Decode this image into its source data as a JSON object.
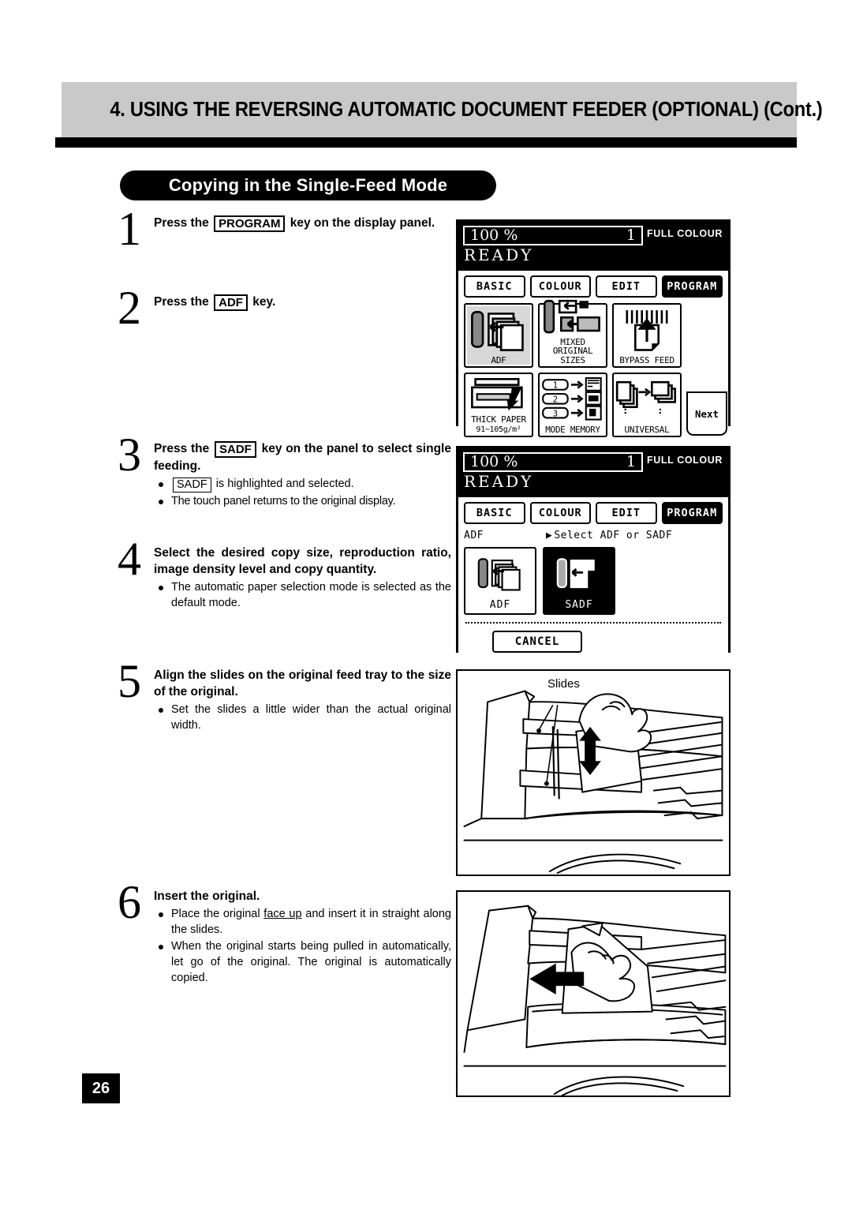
{
  "header": {
    "chapter_title": "4. USING THE REVERSING AUTOMATIC DOCUMENT FEEDER (OPTIONAL) (Cont.)",
    "section_title": "Copying in the Single-Feed Mode"
  },
  "page_number": "26",
  "steps": [
    {
      "num": "1",
      "head_pre": "Press the",
      "head_key": "PROGRAM",
      "head_post": "key on the display panel.",
      "bullets": []
    },
    {
      "num": "2",
      "head_pre": "Press the",
      "head_key": "ADF",
      "head_post": "key.",
      "bullets": []
    },
    {
      "num": "3",
      "head_pre": "Press the",
      "head_key": "SADF",
      "head_post": "key on the panel to select single feeding.",
      "bullets": [
        {
          "key": "SADF",
          "text": "is highlighted and selected."
        },
        {
          "key": "",
          "text": "The touch panel returns to the original display."
        }
      ]
    },
    {
      "num": "4",
      "head_pre": "",
      "head_key": "",
      "head_post": "Select the desired copy size, reproduction ratio, image density level and copy quantity.",
      "bullets": [
        {
          "key": "",
          "text": "The automatic paper selection mode is selected as the default mode."
        }
      ]
    },
    {
      "num": "5",
      "head_pre": "",
      "head_key": "",
      "head_post": "Align the slides on the original feed tray to the size of the original.",
      "bullets": [
        {
          "key": "",
          "text": "Set the slides a little wider than the actual original width."
        }
      ]
    },
    {
      "num": "6",
      "head_pre": "",
      "head_key": "",
      "head_post": "Insert the original.",
      "bullets": [
        {
          "key": "",
          "text": "Place the original face up and insert it in straight along the slides."
        },
        {
          "key": "",
          "text": "When the original starts being pulled in automatically, let go of the original. The original is automatically copied."
        }
      ]
    }
  ],
  "lcd_basic": {
    "ratio": "100",
    "percent": "%",
    "copies": "1",
    "colour_mode": "FULL COLOUR",
    "status": "READY",
    "tabs": [
      {
        "label": "BASIC",
        "selected": false
      },
      {
        "label": "COLOUR",
        "selected": false
      },
      {
        "label": "EDIT",
        "selected": false
      },
      {
        "label": "PROGRAM",
        "selected": true
      }
    ],
    "buttons": [
      {
        "label": "ADF",
        "icon": "adf-icon",
        "highlighted": true
      },
      {
        "label": "MIXED ORIGINAL SIZES",
        "icon": "mixed-original-sizes-icon",
        "highlighted": false
      },
      {
        "label": "BYPASS FEED",
        "icon": "bypass-feed-icon",
        "highlighted": false
      },
      {
        "label": "THICK PAPER 91~105g/m²",
        "icon": "thick-paper-icon",
        "highlighted": false
      },
      {
        "label": "MODE MEMORY",
        "icon": "mode-memory-icon",
        "highlighted": false
      },
      {
        "label": "UNIVERSAL",
        "icon": "universal-icon",
        "highlighted": false
      }
    ],
    "mode_memory_slots": [
      "1",
      "2",
      "3"
    ],
    "next_label": "Next"
  },
  "lcd_sadf": {
    "ratio": "100",
    "percent": "%",
    "copies": "1",
    "colour_mode": "FULL COLOUR",
    "status": "READY",
    "tabs": [
      {
        "label": "BASIC",
        "selected": false
      },
      {
        "label": "COLOUR",
        "selected": false
      },
      {
        "label": "EDIT",
        "selected": false
      },
      {
        "label": "PROGRAM",
        "selected": true
      }
    ],
    "mode_label": "ADF",
    "prompt": "Select ADF or SADF",
    "choices": [
      {
        "label": "ADF",
        "icon": "adf-icon",
        "selected": false
      },
      {
        "label": "SADF",
        "icon": "sadf-icon",
        "selected": true
      }
    ],
    "cancel_label": "CANCEL"
  },
  "illustrations": {
    "slides": {
      "callout": "Slides",
      "caption": ""
    },
    "insert": {
      "caption": ""
    }
  },
  "colors": {
    "header_grey": "#c9c9c9",
    "ink": "#000000",
    "paper": "#ffffff",
    "button_shade": "#d8d8d8"
  }
}
